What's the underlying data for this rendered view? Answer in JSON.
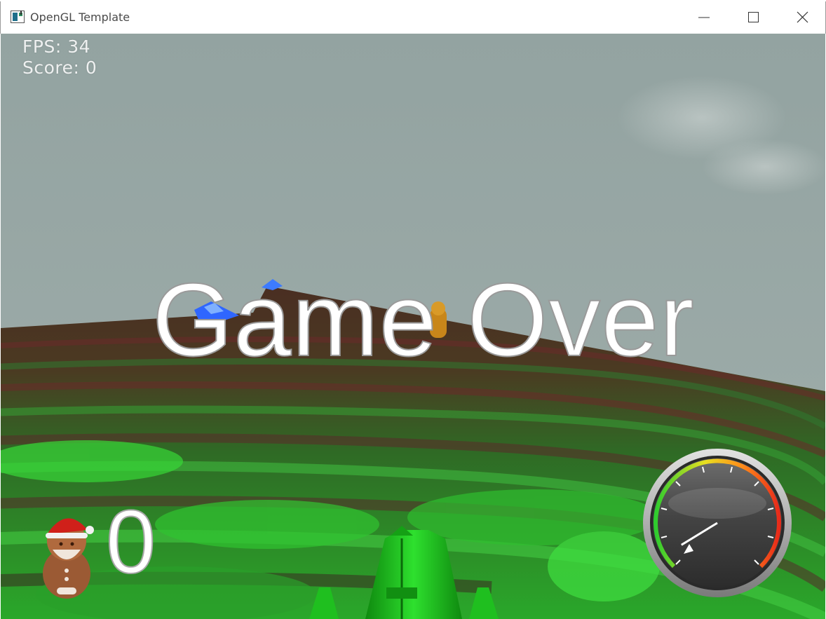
{
  "window": {
    "title": "OpenGL Template",
    "buttons": [
      "minimize",
      "maximize",
      "close"
    ]
  },
  "hud": {
    "fps_label": "FPS: 34",
    "score_label": "Score: 0",
    "game_over": "Game Over",
    "gifts_collected": "0",
    "speedometer_level": 0.05
  },
  "icons": {
    "app": "opengl-app-icon",
    "collectible_counter": "gingerbread-santa-icon",
    "speedometer": "speedometer-gauge",
    "player": "green-sled-ship"
  },
  "colors": {
    "sky": "#97a6a3",
    "terrain_green": "#2fd22f",
    "terrain_brown": "#5a3324",
    "ship_green": "#19c019",
    "gauge_needle": "#ffffff"
  }
}
